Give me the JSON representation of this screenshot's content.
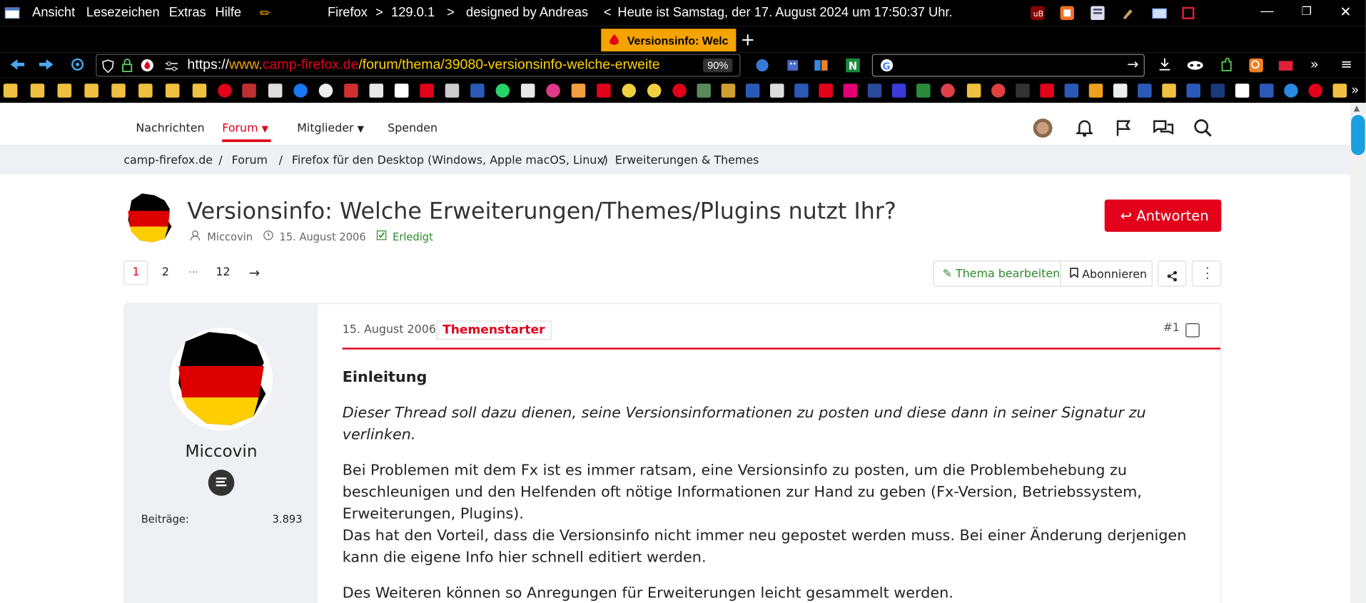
{
  "menubar": {
    "items": [
      "Ansicht",
      "Lesezeichen",
      "Extras",
      "Hilfe"
    ],
    "title_parts": [
      "Firefox",
      ">",
      "129.0.1",
      ">",
      "designed by Andreas",
      "<",
      "Heute ist Samstag, der 17. August 2024 um 17:50:37 Uhr."
    ]
  },
  "tab": {
    "label": "Versionsinfo: Welc"
  },
  "url": {
    "scheme": "https://",
    "host_www": "www.",
    "host": "camp-firefox.de",
    "path": [
      "forum",
      "thema",
      "39080-versionsinfo-welche-erweite"
    ],
    "zoom": "90%"
  },
  "site_nav": {
    "items": [
      "Nachrichten",
      "Forum",
      "Mitglieder",
      "Spenden"
    ]
  },
  "breadcrumb": [
    "camp-firefox.de",
    "Forum",
    "Firefox für den Desktop (Windows, Apple macOS, Linux)",
    "Erweiterungen & Themes"
  ],
  "thread": {
    "title": "Versionsinfo: Welche Erweiterungen/Themes/Plugins nutzt Ihr?",
    "author": "Miccovin",
    "date": "15. August 2006",
    "status": "Erledigt",
    "reply_button": "Antworten",
    "pages": [
      "1",
      "2",
      "···",
      "12"
    ],
    "edit_button": "Thema bearbeiten",
    "subscribe_button": "Abonnieren"
  },
  "post": {
    "username": "Miccovin",
    "stats_label": "Beiträge:",
    "stats_value": "3.893",
    "date": "15. August 2006",
    "badge": "Themenstarter",
    "number": "#1",
    "heading": "Einleitung",
    "intro": "Dieser Thread soll dazu dienen, seine Versionsinformationen zu posten und diese dann in seiner Signatur zu verlinken.",
    "para1": "Bei Problemen mit dem Fx ist es immer ratsam, eine Versionsinfo zu posten, um die Problembehebung zu beschleunigen und den Helfenden oft nötige Informationen zur Hand zu geben (Fx-Version, Betriebssystem, Erweiterungen, Plugins).",
    "para2": "Das hat den Vorteil, dass die Versionsinfo nicht immer neu gepostet werden muss. Bei einer Änderung derjenigen kann die eigene Info hier schnell editiert werden.",
    "para3": "Des Weiteren können so Anregungen für Erweiterungen leicht gesammelt werden."
  },
  "colors": {
    "accent": "#e2001a",
    "green": "#2e8b2e",
    "url_host": "#e2001a",
    "url_www": "#f5a300",
    "url_path": "#ffd400"
  }
}
